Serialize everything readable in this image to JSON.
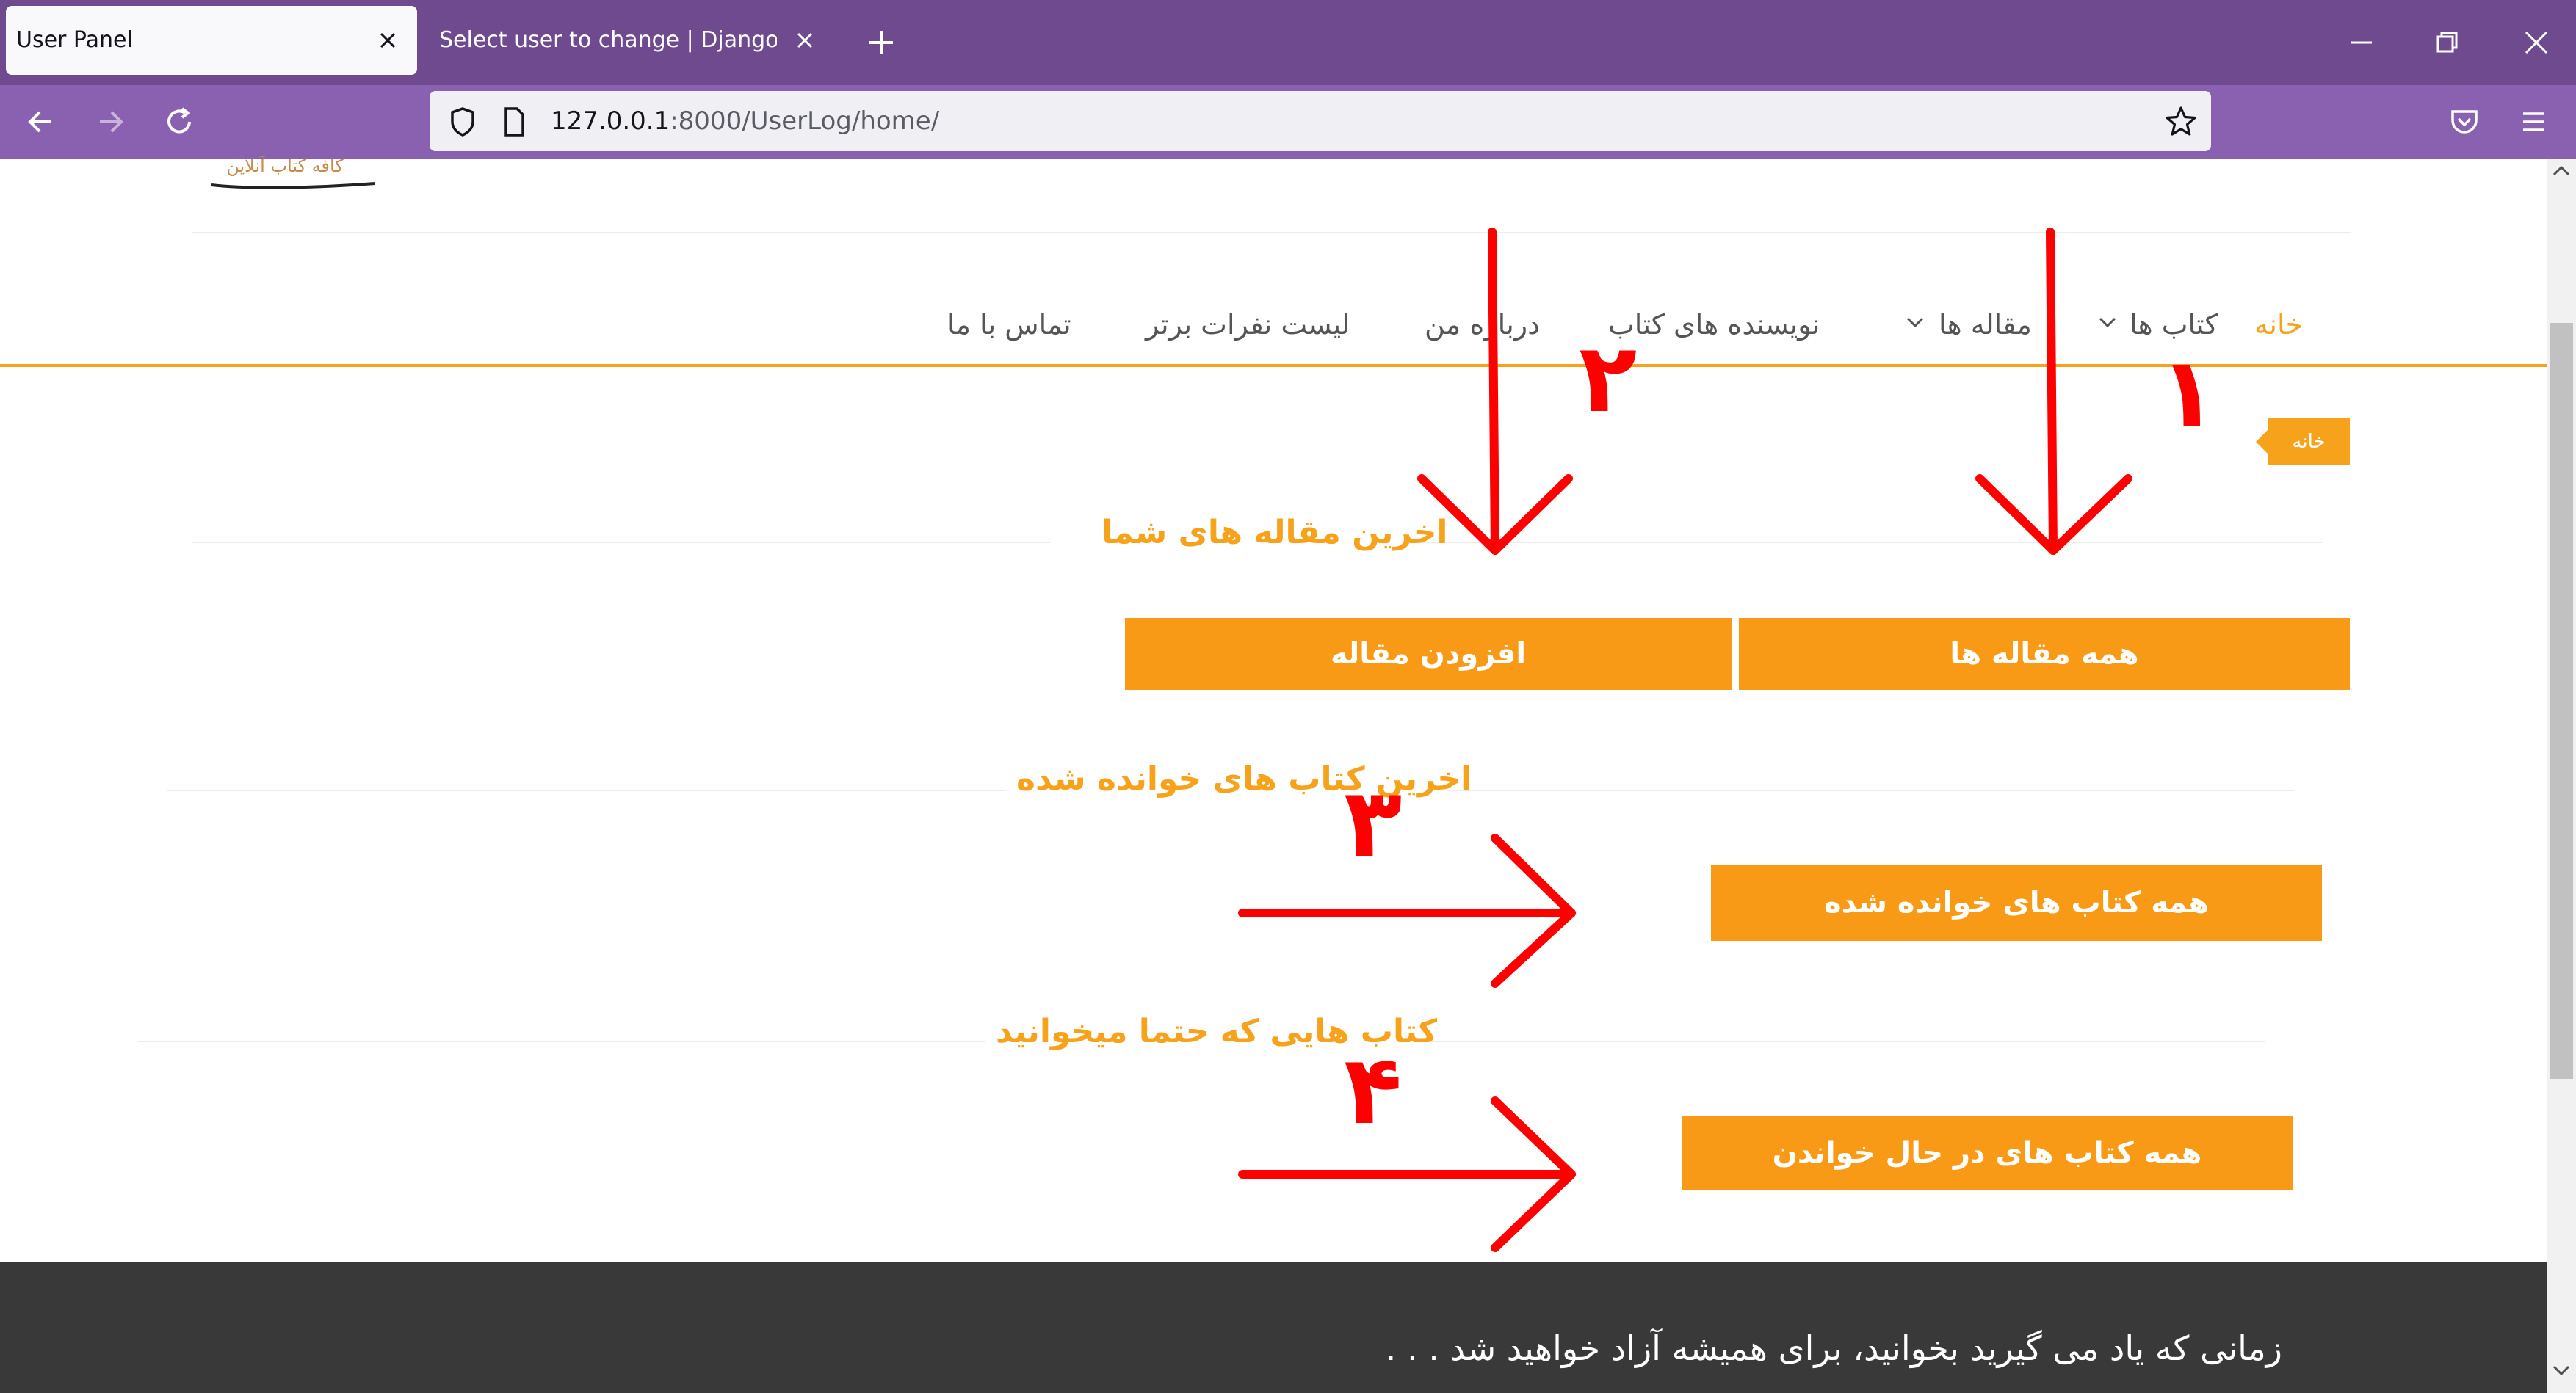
{
  "browser": {
    "tabs": [
      {
        "title": "User Panel"
      },
      {
        "title": "Select user to change | Django site a"
      }
    ],
    "url": {
      "host": "127.0.0.1",
      "rest": ":8000/UserLog/home/"
    }
  },
  "site": {
    "logo_text": "کافه کتاب آنلاین",
    "nav": {
      "home": "خانه",
      "books": "کتاب ها",
      "articles": "مقاله ها",
      "authors": "نویسنده های کتاب",
      "about": "درباره من",
      "top_list": "لیست نفرات برتر",
      "contact": "تماس با ما"
    },
    "breadcrumb": "خانه"
  },
  "main": {
    "articles_title": "اخرین مقاله های شما",
    "all_articles_button": "همه مقاله ها",
    "add_article_button": "افزودن مقاله",
    "read_books_title": "اخرین کتاب های خوانده شده",
    "all_read_books_button": "همه کتاب های خوانده شده",
    "must_read_title": "کتاب هایی که حتما میخوانید",
    "reading_books_button": "همه کتاب های در حال خواندن"
  },
  "footer": {
    "quote": "زمانی که یاد می گیرید بخوانید، برای همیشه آزاد خواهید شد . . ."
  },
  "annotations": [
    "۱",
    "۲",
    "۳",
    "۴"
  ],
  "colors": {
    "accent": "#f99a16",
    "browser_frame": "#6f4a8e",
    "annotation": "#ff0000"
  }
}
